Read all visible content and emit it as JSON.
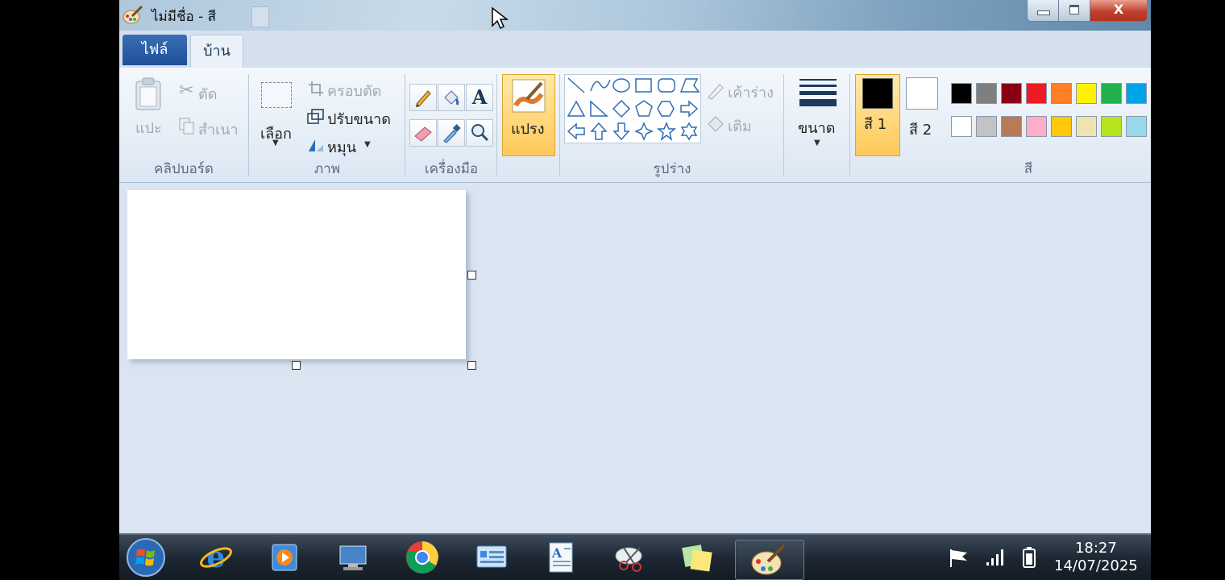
{
  "window": {
    "title": "ไม่มีชื่อ - สี",
    "close_label": "X"
  },
  "tabs": {
    "file": "ไฟล์",
    "home": "บ้าน"
  },
  "clipboard": {
    "paste": "แปะ",
    "cut": "ตัด",
    "copy": "สำเนา",
    "group": "คลิปบอร์ด"
  },
  "image": {
    "select": "เลือก",
    "crop": "ครอบตัด",
    "resize": "ปรับขนาด",
    "rotate": "หมุน",
    "group": "ภาพ"
  },
  "tools": {
    "group": "เครื่องมือ",
    "text_tool": "A"
  },
  "brushes": {
    "label": "แปรง"
  },
  "shapes": {
    "outline": "เค้าร่าง",
    "fill": "เติม",
    "group": "รูปร่าง"
  },
  "size": {
    "label": "ขนาด"
  },
  "colors": {
    "color1": "สี 1",
    "color2": "สี 2",
    "group": "สี",
    "color1_value": "#000000",
    "color2_value": "#ffffff",
    "row1": [
      "#000000",
      "#7f7f7f",
      "#880015",
      "#ed1c24",
      "#ff7f27",
      "#fff200",
      "#22b14c",
      "#00a2e8"
    ],
    "row2": [
      "#ffffff",
      "#c3c3c3",
      "#b97a57",
      "#ffaec9",
      "#ffc90e",
      "#efe4b0",
      "#b5e61d",
      "#99d9ea"
    ]
  },
  "taskbar": {
    "time": "18:27",
    "date": "14/07/2025"
  }
}
